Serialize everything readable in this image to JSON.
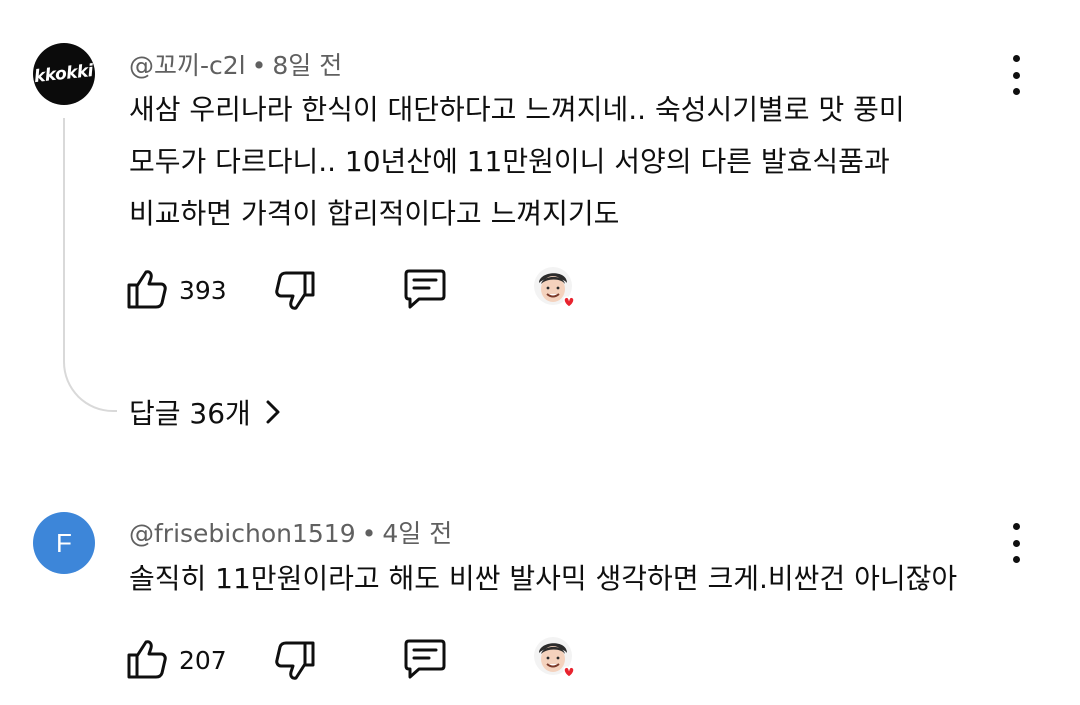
{
  "comments": [
    {
      "avatar_text": "kkokki",
      "handle": "@꼬끼-c2l",
      "separator": "•",
      "time": "8일 전",
      "lines": [
        "새삼 우리나라 한식이 대단하다고 느껴지네.. 숙성시기별로 맛 풍미",
        "모두가 다르다니.. 10년산에 11만원이니 서양의 다른 발효식품과",
        "비교하면 가격이 합리적이다고 느껴지기도"
      ],
      "likes": "393",
      "replies_label": "답글 36개"
    },
    {
      "avatar_text": "F",
      "handle": "@frisebichon1519",
      "separator": "•",
      "time": "4일 전",
      "lines": [
        "솔직히 11만원이라고 해도 비싼 발사믹 생각하면 크게.비싼건 아니잖아"
      ],
      "likes": "207"
    }
  ],
  "colors": {
    "meta_text": "#606060",
    "avatar_blue": "#3d86d9",
    "heart": "#e8232e"
  }
}
